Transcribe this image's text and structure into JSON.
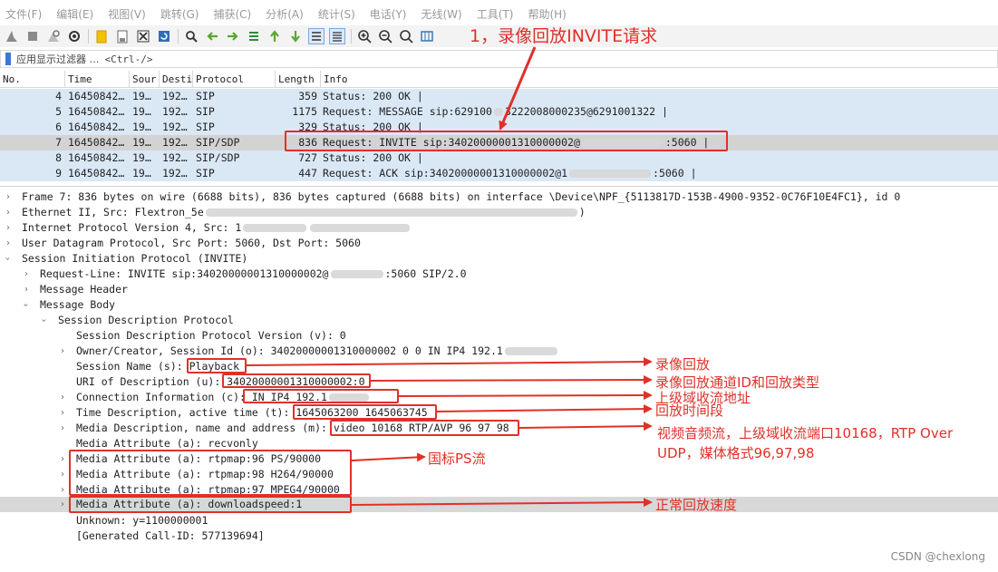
{
  "menu": [
    "文件(F)",
    "编辑(E)",
    "视图(V)",
    "跳转(G)",
    "捕获(C)",
    "分析(A)",
    "统计(S)",
    "电话(Y)",
    "无线(W)",
    "工具(T)",
    "帮助(H)"
  ],
  "toolbar": [
    "shark-fin-start-icon",
    "stop-icon",
    "restart-icon",
    "options-gear-icon",
    "open-folder-icon",
    "save-file-icon",
    "close-file-icon",
    "reload-icon",
    "find-magnifier-icon",
    "go-back-arrow-icon",
    "go-forward-arrow-icon",
    "go-to-packet-icon",
    "go-first-icon",
    "go-last-icon",
    "autoscroll-icon",
    "colorize-icon",
    "zoom-in-icon",
    "zoom-out-icon",
    "zoom-normal-icon",
    "resize-columns-icon"
  ],
  "filter": {
    "placeholder": "应用显示过滤器 …",
    "shortcut": "<Ctrl-/>"
  },
  "columns": [
    "No.",
    "Time",
    "Sour",
    "Desti",
    "Protocol",
    "Length",
    "Info"
  ],
  "packets": [
    {
      "no": "4",
      "time": "16450842…",
      "src": "19…",
      "dst": "192…",
      "proto": "SIP",
      "len": "359",
      "info": "Status: 200 OK |"
    },
    {
      "no": "5",
      "time": "16450842…",
      "src": "19…",
      "dst": "192…",
      "proto": "SIP",
      "len": "1175",
      "info": "Request: MESSAGE sip:629100",
      "info_tail": "3222008000235@6291001322 |"
    },
    {
      "no": "6",
      "time": "16450842…",
      "src": "19…",
      "dst": "192…",
      "proto": "SIP",
      "len": "329",
      "info": "Status: 200 OK |"
    },
    {
      "no": "7",
      "time": "16450842…",
      "src": "19…",
      "dst": "192…",
      "proto": "SIP/SDP",
      "len": "836",
      "info": "Request: INVITE sip:34020000001310000002@",
      "info_tail": ":5060 |"
    },
    {
      "no": "8",
      "time": "16450842…",
      "src": "19…",
      "dst": "192…",
      "proto": "SIP/SDP",
      "len": "727",
      "info": "Status: 200 OK |"
    },
    {
      "no": "9",
      "time": "16450842…",
      "src": "19…",
      "dst": "192…",
      "proto": "SIP",
      "len": "447",
      "info": "Request: ACK sip:34020000001310000002@1",
      "info_tail": ":5060 |"
    }
  ],
  "details": {
    "frame": "Frame 7: 836 bytes on wire (6688 bits), 836 bytes captured (6688 bits) on interface \\Device\\NPF_{5113817D-153B-4900-9352-0C76F10E4FC1}, id 0",
    "eth": "Ethernet II, Src: Flextron_5e",
    "eth_tail": ")",
    "ip": "Internet Protocol Version 4, Src: 1",
    "udp": "User Datagram Protocol, Src Port: 5060, Dst Port: 5060",
    "sip": "Session Initiation Protocol (INVITE)",
    "req_line": "Request-Line: INVITE sip:34020000001310000002@",
    "req_line_tail": ":5060 SIP/2.0",
    "msg_header": "Message Header",
    "msg_body": "Message Body",
    "sdp": "Session Description Protocol",
    "version": "Session Description Protocol Version (v): 0",
    "owner": "Owner/Creator, Session Id (o): 34020000001310000002 0 0 IN IP4 192.1",
    "sname_label": "Session Name (s): ",
    "sname_value": "Playback",
    "uri_label": "URI of Description (u): ",
    "uri_value": "34020000001310000002:0",
    "conn_label": "Connection Information (c): ",
    "conn_value": "IN IP4 192.1",
    "time_label": "Time Description, active time (t): ",
    "time_value": "1645063200 1645063745",
    "media_label": "Media Description, name and address (m): ",
    "media_value": "video 10168 RTP/AVP 96 97 98",
    "attr_recv": "Media Attribute (a): recvonly",
    "attr_96": "Media Attribute (a): rtpmap:96 PS/90000",
    "attr_98": "Media Attribute (a): rtpmap:98 H264/90000",
    "attr_97": "Media Attribute (a): rtpmap:97 MPEG4/90000",
    "attr_speed": "Media Attribute (a): downloadspeed:1",
    "unknown": "Unknown: y=1100000001",
    "callid": "[Generated Call-ID: 577139694]"
  },
  "annotations": {
    "title": "1，录像回放INVITE请求",
    "playback": "录像回放",
    "uri": "录像回放通道ID和回放类型",
    "conn": "上级域收流地址",
    "time": "回放时间段",
    "media_1": "视频音频流，上级域收流端口10168，RTP Over",
    "media_2": "UDP，媒体格式96,97,98",
    "ps": "国标PS流",
    "speed": "正常回放速度"
  },
  "watermark": "CSDN @chexlong",
  "colors": {
    "row_selected": "#d3d3d3",
    "row_sip": "#dae8f6",
    "annotation": "#e0302a"
  }
}
